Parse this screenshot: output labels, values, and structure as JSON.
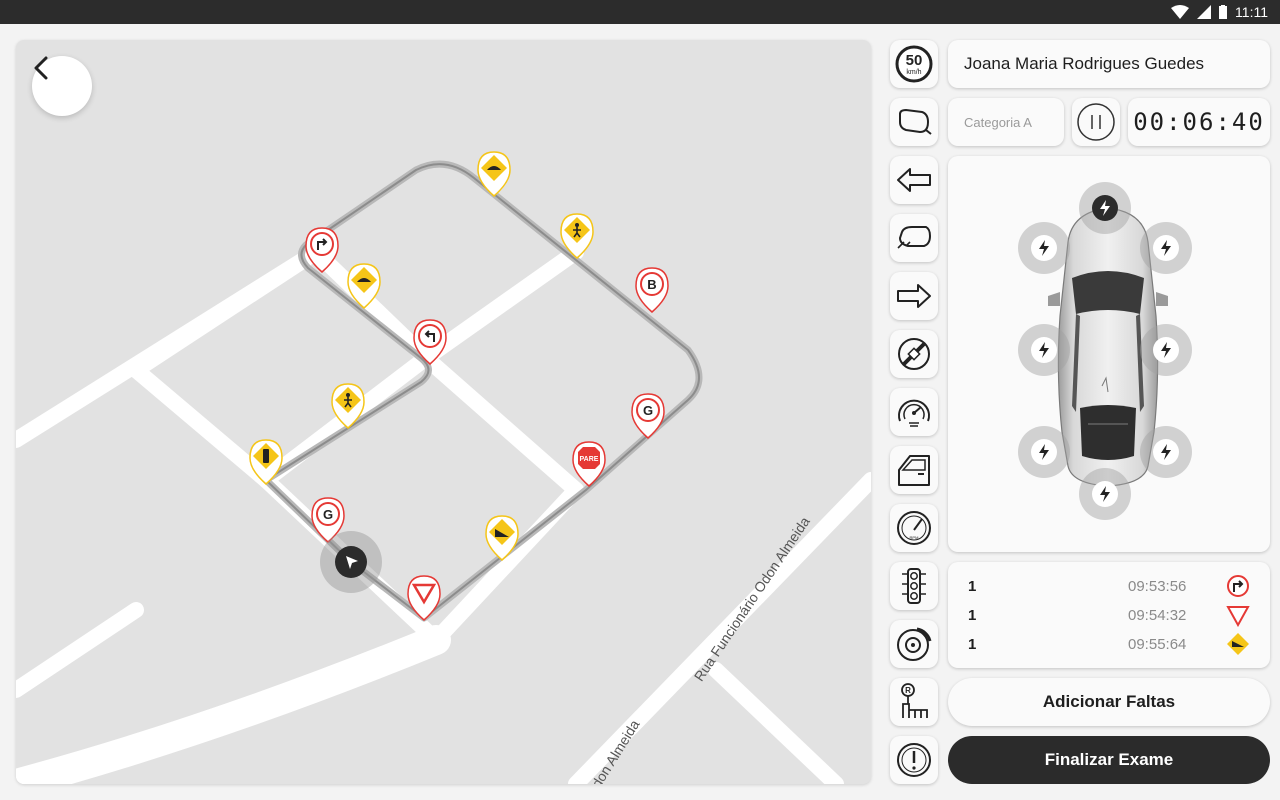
{
  "status_bar": {
    "time": "11:11"
  },
  "map": {
    "street_labels": [
      "Rua Funcionário Odon Almeida",
      "Odon Almeida"
    ]
  },
  "speed_limit": {
    "value": "50",
    "unit": "km/h"
  },
  "candidate": {
    "name": "Joana Maria Rodrigues Guedes"
  },
  "exam": {
    "category": "Categoria A",
    "timer": "00:06:40"
  },
  "side_icons": [
    "speed-limit-icon",
    "mirror-icon",
    "arrow-left-icon",
    "side-mirror-icon",
    "arrow-right-icon",
    "seatbelt-icon",
    "dashboard-icon",
    "door-icon",
    "speedometer-icon",
    "traffic-light-icon",
    "brake-icon",
    "gear-shift-icon",
    "warning-icon"
  ],
  "infractions": [
    {
      "count": "1",
      "time": "09:53:56",
      "icon": "turn-right-sign-icon"
    },
    {
      "count": "1",
      "time": "09:54:32",
      "icon": "yield-sign-icon"
    },
    {
      "count": "1",
      "time": "09:55:64",
      "icon": "speed-bump-sign-icon"
    }
  ],
  "actions": {
    "add_label": "Adicionar Faltas",
    "finish_label": "Finalizar Exame"
  },
  "colors": {
    "accent_dark": "#2b2b2b",
    "route": "#9a9a9a",
    "warning_yellow": "#f5c518",
    "regulatory_red": "#e53935"
  }
}
